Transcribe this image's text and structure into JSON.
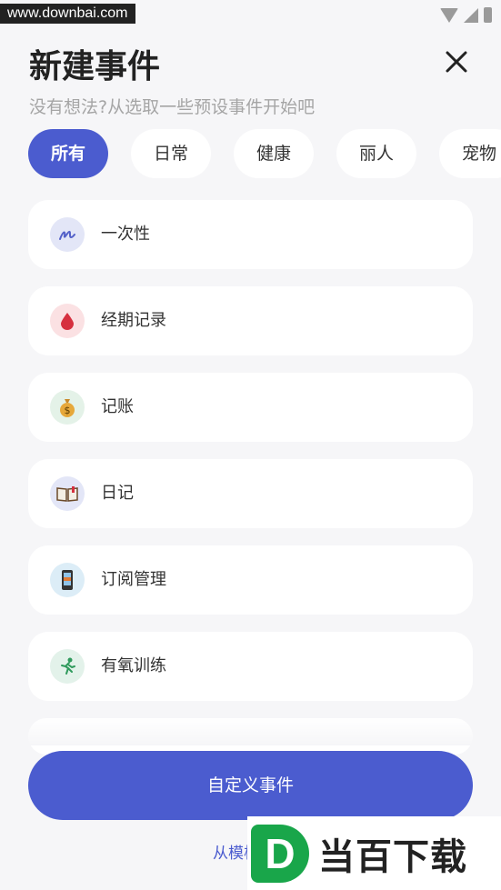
{
  "status_bar": {
    "watermark_url": "www.downbai.com",
    "icons": [
      "wifi-icon",
      "signal-icon",
      "battery-icon"
    ]
  },
  "header": {
    "title": "新建事件",
    "subtitle": "没有想法?从选取一些预设事件开始吧",
    "close_icon": "close-icon"
  },
  "tabs": [
    {
      "label": "所有",
      "active": true
    },
    {
      "label": "日常",
      "active": false
    },
    {
      "label": "健康",
      "active": false
    },
    {
      "label": "丽人",
      "active": false
    },
    {
      "label": "宠物",
      "active": false
    }
  ],
  "events": [
    {
      "label": "一次性",
      "icon": "scribble-icon",
      "icon_bg": "#e3e6f7"
    },
    {
      "label": "经期记录",
      "icon": "blood-drop-icon",
      "icon_bg": "#fbe1e3"
    },
    {
      "label": "记账",
      "icon": "money-bag-icon",
      "icon_bg": "#e4f2e8"
    },
    {
      "label": "日记",
      "icon": "open-book-icon",
      "icon_bg": "#e3e6f7"
    },
    {
      "label": "订阅管理",
      "icon": "phone-icon",
      "icon_bg": "#dcedf7"
    },
    {
      "label": "有氧训练",
      "icon": "running-icon",
      "icon_bg": "#e3f2ea"
    }
  ],
  "footer": {
    "primary_button": "自定义事件",
    "template_link": "从模板"
  },
  "logo": {
    "mark": "D",
    "text": "当百下载"
  },
  "colors": {
    "accent": "#4b5ccf",
    "background": "#f6f6f8",
    "card": "#ffffff"
  }
}
